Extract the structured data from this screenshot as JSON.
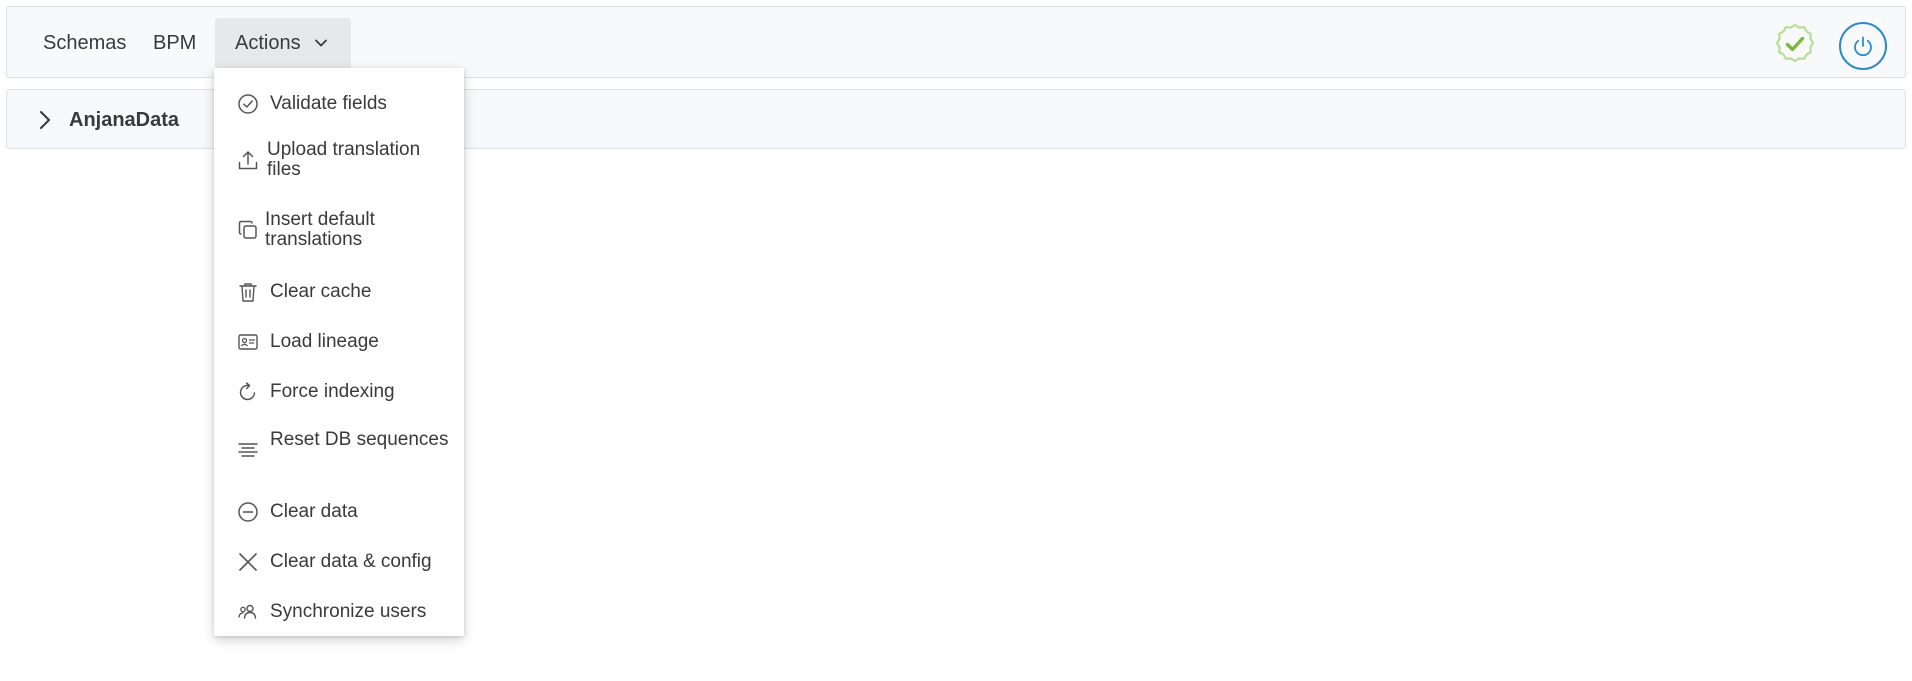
{
  "nav": {
    "schemas": "Schemas",
    "bpm": "BPM",
    "actions": "Actions"
  },
  "panel": {
    "title": "AnjanaData"
  },
  "menu": {
    "items": [
      {
        "label": "Validate fields",
        "icon": "check-circle-icon"
      },
      {
        "label": "Upload translation files",
        "icon": "upload-icon"
      },
      {
        "label": "Insert default translations",
        "icon": "copy-icon"
      },
      {
        "label": "Clear cache",
        "icon": "trash-icon"
      },
      {
        "label": "Load lineage",
        "icon": "id-card-icon"
      },
      {
        "label": "Force indexing",
        "icon": "refresh-icon"
      },
      {
        "label": "Reset DB sequences",
        "icon": "align-center-icon"
      },
      {
        "label": "Clear data",
        "icon": "minus-circle-icon"
      },
      {
        "label": "Clear data & config",
        "icon": "close-icon"
      },
      {
        "label": "Synchronize users",
        "icon": "users-icon"
      }
    ]
  },
  "colors": {
    "status_ok": "#7cb83a",
    "power": "#2e8bc9",
    "text": "#3a3a3a"
  }
}
